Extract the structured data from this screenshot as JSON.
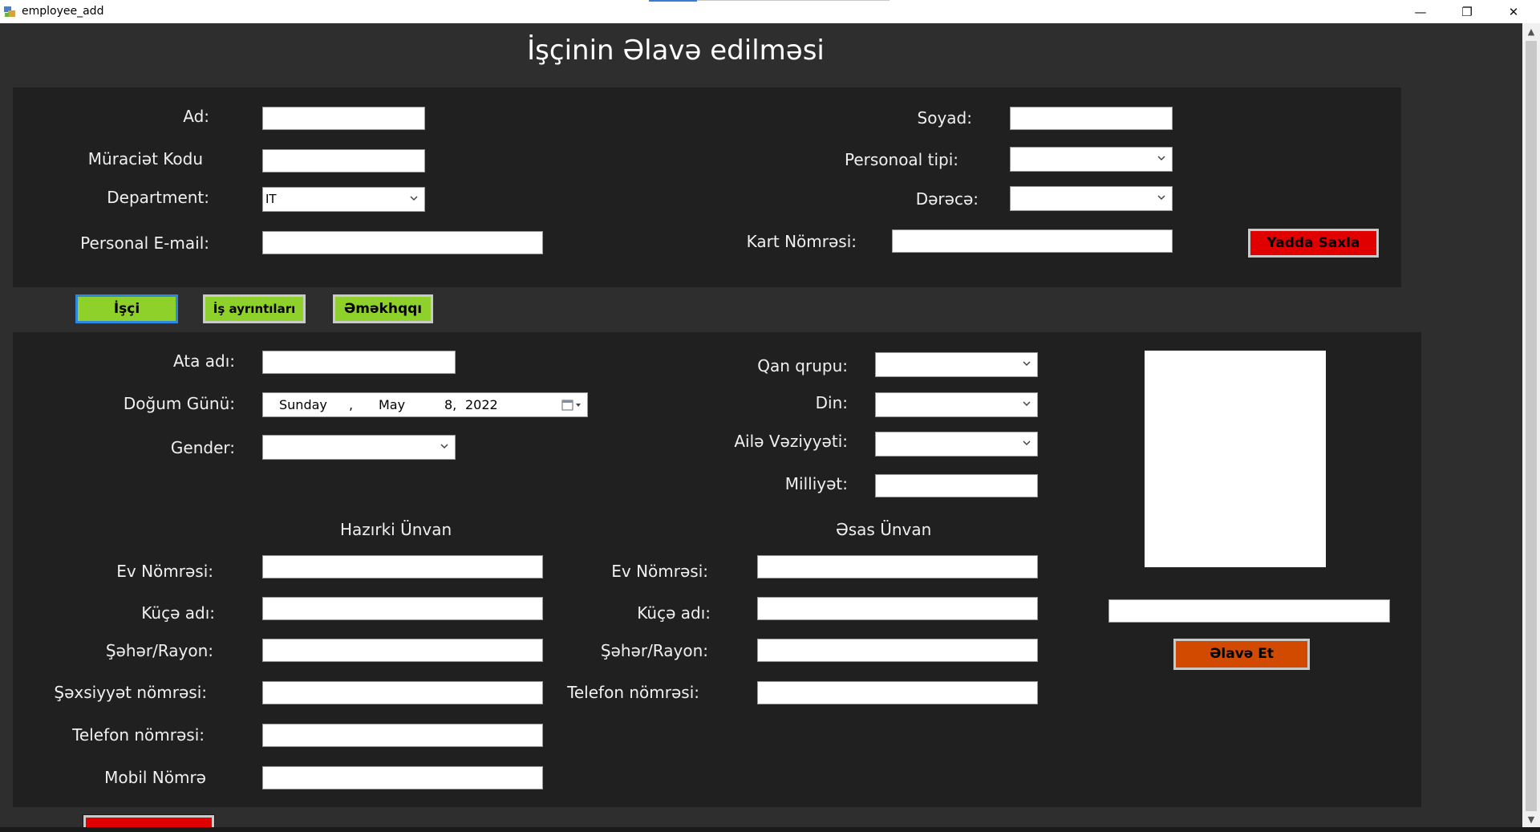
{
  "window": {
    "title": "employee_add",
    "minimize_glyph": "—",
    "restore_glyph": "❐",
    "close_glyph": "✕"
  },
  "page": {
    "title": "İşçinin Əlavə edilməsi"
  },
  "top_form": {
    "ad_label": "Ad:",
    "soyad_label": "Soyad:",
    "muraciet_label": "Müraciət Kodu",
    "personoal_label": "Personoal tipi:",
    "department_label": "Department:",
    "department_value": "IT",
    "derece_label": "Dərəcə:",
    "email_label": "Personal E-mail:",
    "kart_label": "Kart Nömrəsi:",
    "save_button": "Yadda Saxla"
  },
  "tabs": [
    {
      "label": "İşçi",
      "active": true
    },
    {
      "label": "İş ayrıntıları",
      "active": false
    },
    {
      "label": "Əməkhqqı",
      "active": false
    }
  ],
  "details": {
    "ata_adi_label": "Ata adı:",
    "dogum_label": "Doğum Günü:",
    "date": {
      "weekday": "Sunday",
      "sep": ",",
      "month": "May",
      "day": "8,",
      "year": "2022"
    },
    "gender_label": "Gender:",
    "qan_label": "Qan qrupu:",
    "din_label": "Din:",
    "aile_label": "Ailə Vəziyyəti:",
    "milliyet_label": "Milliyət:"
  },
  "current_address": {
    "heading": "Hazırki Ünvan",
    "ev_label": "Ev Nömrəsi:",
    "kuce_label": "Küçə adı:",
    "seher_label": "Şəhər/Rayon:",
    "sexsiyyet_label": "Şəxsiyyət nömrəsi:",
    "telefon_label": "Telefon nömrəsi:",
    "mobil_label": "Mobil Nömrə"
  },
  "main_address": {
    "heading": "Əsas Ünvan",
    "ev_label": "Ev Nömrəsi:",
    "kuce_label": "Küçə adı:",
    "seher_label": "Şəhər/Rayon:",
    "telefon_label": "Telefon nömrəsi:"
  },
  "photo_section": {
    "add_button": "Əlavə Et"
  },
  "icons": {
    "app": "app-icon",
    "chevron": "chevron-down-icon",
    "calendar": "calendar-icon"
  },
  "colors": {
    "background": "#2e2e2e",
    "panel": "#202020",
    "save_red": "#e00000",
    "tab_green": "#8ed12b",
    "add_orange": "#d24a00",
    "active_tab_border": "#2f88e0"
  }
}
